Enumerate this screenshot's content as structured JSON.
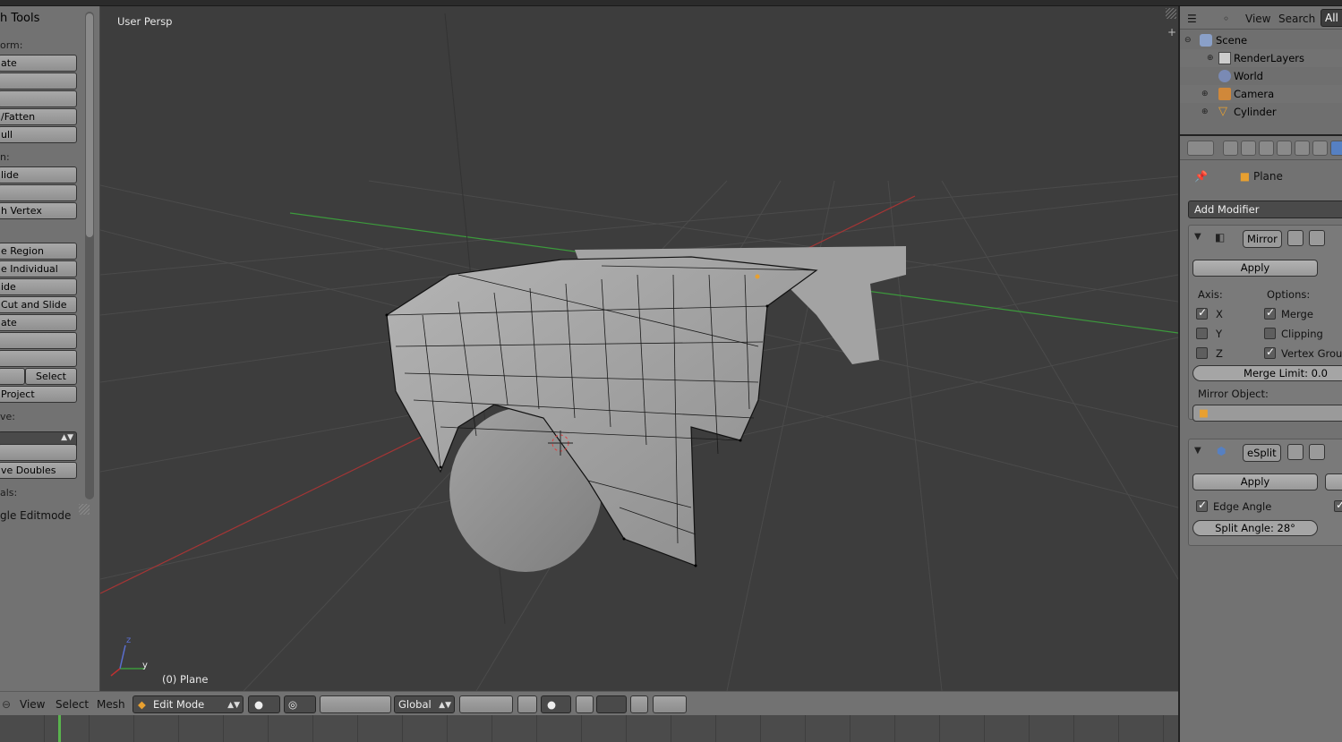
{
  "toolshelf": {
    "title": "h Tools",
    "sections": {
      "transform": "orm:",
      "deform": "n:",
      "remove": "ve:",
      "normals": "als:"
    },
    "buttons": [
      "ate",
      "",
      "",
      "/Fatten",
      "ull",
      "lide",
      "",
      "h Vertex",
      "e Region",
      "e Individual",
      "ide",
      "Cut and Slide",
      "ate",
      "",
      "",
      "",
      "Project",
      "",
      "ve Doubles"
    ],
    "select_button": "Select",
    "last_label": "gle Editmode"
  },
  "viewport": {
    "perspective_label": "User Persp",
    "object_label": "(0) Plane",
    "axis_z": "z",
    "axis_y": "y"
  },
  "header": {
    "menus": [
      "View",
      "Select",
      "Mesh"
    ],
    "mode": "Edit Mode",
    "orientation": "Global"
  },
  "outliner": {
    "menus": [
      "View",
      "Search"
    ],
    "filter": "All",
    "items": [
      {
        "name": "Scene",
        "icon": "scene-icon"
      },
      {
        "name": "RenderLayers",
        "icon": "renderlayers-icon"
      },
      {
        "name": "World",
        "icon": "world-icon"
      },
      {
        "name": "Camera",
        "icon": "camera-icon"
      },
      {
        "name": "Cylinder",
        "icon": "mesh-icon"
      }
    ]
  },
  "properties": {
    "context_object": "Plane",
    "add_modifier": "Add Modifier",
    "mirror": {
      "name": "Mirror",
      "apply": "Apply",
      "axis_label": "Axis:",
      "options_label": "Options:",
      "axes": [
        {
          "label": "X",
          "checked": true
        },
        {
          "label": "Y",
          "checked": false
        },
        {
          "label": "Z",
          "checked": false
        }
      ],
      "options": [
        {
          "label": "Merge",
          "checked": true
        },
        {
          "label": "Clipping",
          "checked": false
        },
        {
          "label": "Vertex Groups",
          "checked": true
        }
      ],
      "merge_limit": "Merge Limit: 0.0",
      "mirror_object_label": "Mirror Object:"
    },
    "edgesplit": {
      "name": "eSplit",
      "apply": "Apply",
      "edge_angle": "Edge Angle",
      "edge_angle_checked": true,
      "split_angle": "Split Angle: 28°"
    }
  },
  "colors": {
    "viewport_bg": "#3d3d3d",
    "panel_bg": "#727272",
    "x_axis": "#b03030",
    "y_axis": "#3c9a3c",
    "timeline_cursor": "#59b34d",
    "active_tab": "#5680c2"
  }
}
